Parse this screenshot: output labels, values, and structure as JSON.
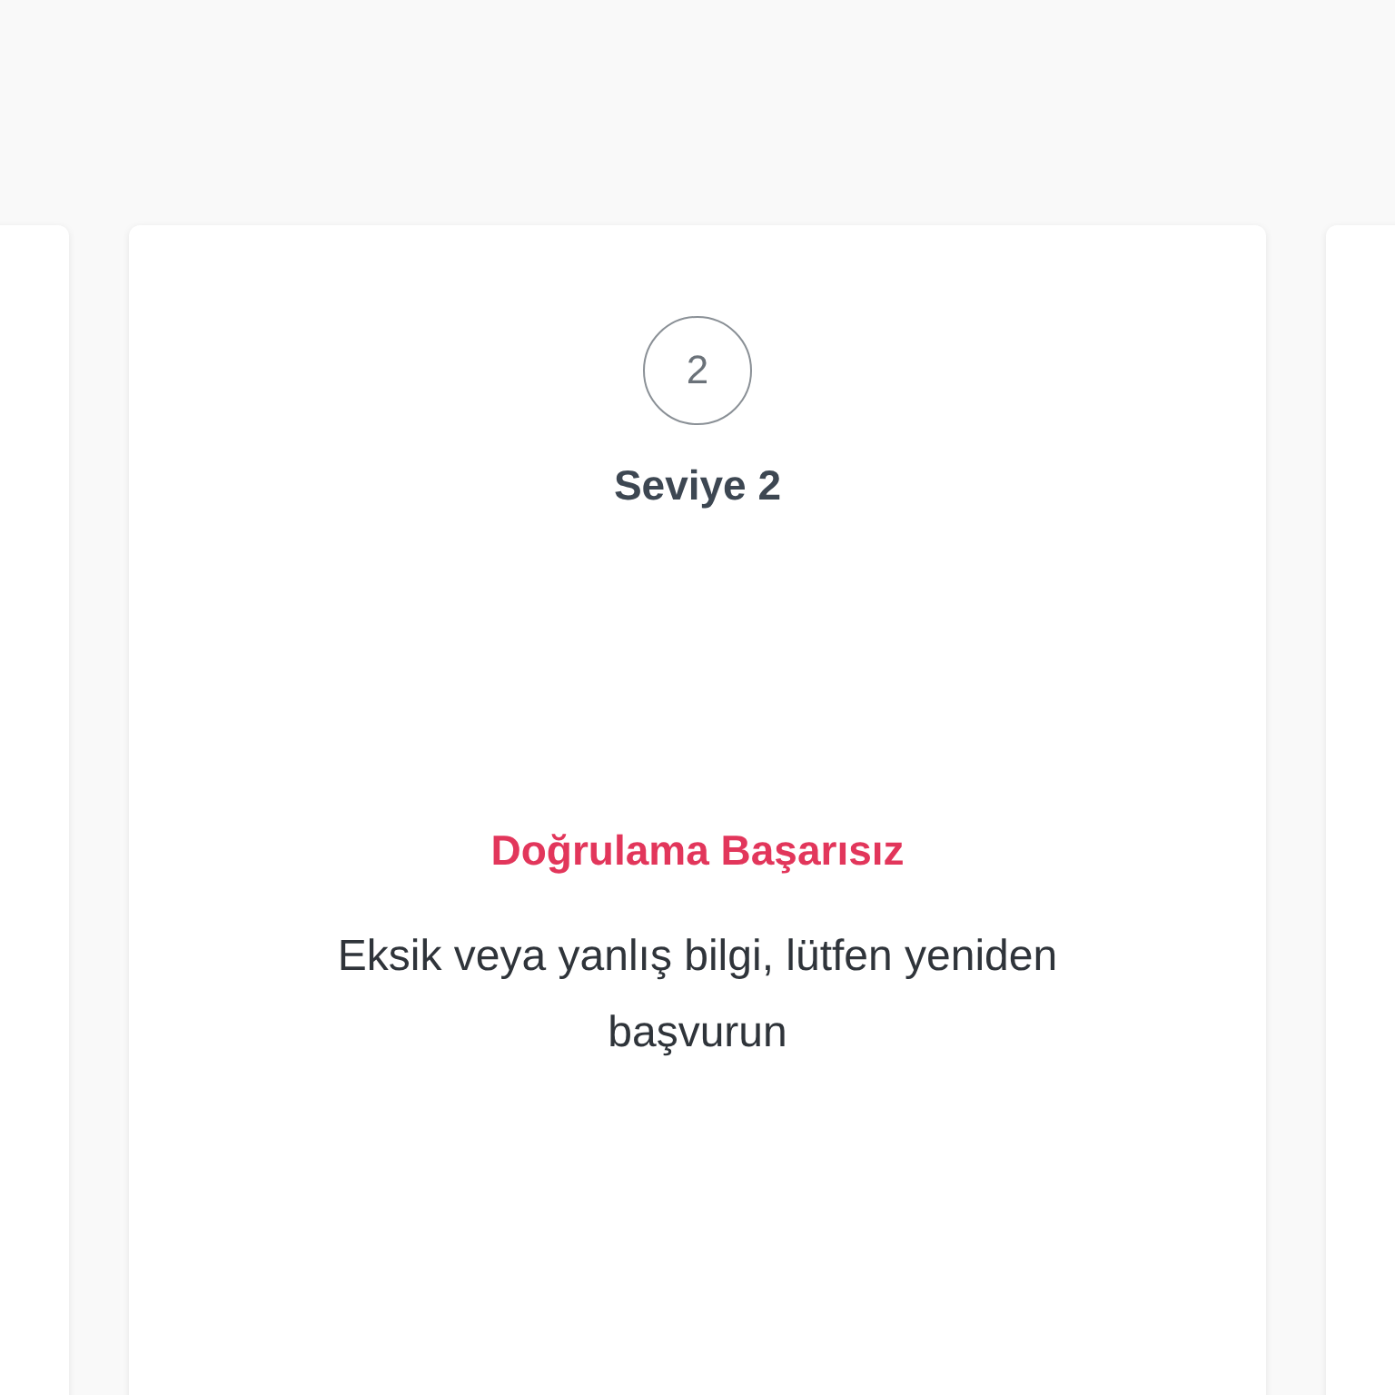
{
  "card": {
    "step": "2",
    "level_title": "Seviye 2",
    "status": {
      "kind": "failed",
      "title": "Doğrulama Başarısız",
      "message": "Eksik veya yanlış bilgi, lütfen yeniden başvurun"
    }
  }
}
